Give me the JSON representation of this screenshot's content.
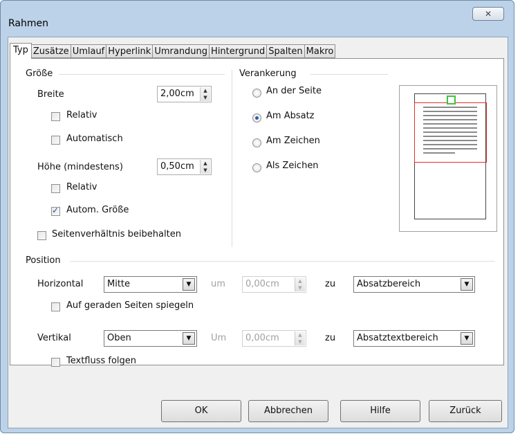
{
  "window": {
    "title": "Rahmen",
    "close_icon": "close-icon"
  },
  "tabs": [
    "Typ",
    "Zusätze",
    "Umlauf",
    "Hyperlink",
    "Umrandung",
    "Hintergrund",
    "Spalten",
    "Makro"
  ],
  "groesse": {
    "title": "Größe",
    "breite_label": "Breite",
    "breite_value": "2,00cm",
    "relativ1_label": "Relativ",
    "automatisch_label": "Automatisch",
    "hoehe_label": "Höhe (mindestens)",
    "hoehe_value": "0,50cm",
    "relativ2_label": "Relativ",
    "autom_groesse_label": "Autom. Größe",
    "seitenverhaeltnis_label": "Seitenverhältnis beibehalten"
  },
  "states": {
    "relativ1": false,
    "automatisch": false,
    "relativ2": false,
    "autom_groesse": true,
    "seitenverhaeltnis": false,
    "auf_geraden": false,
    "textfluss": false
  },
  "verankerung": {
    "title": "Verankerung",
    "options": [
      "An der Seite",
      "Am Absatz",
      "Am Zeichen",
      "Als Zeichen"
    ],
    "selected": 1
  },
  "position": {
    "title": "Position",
    "horizontal_label": "Horizontal",
    "horizontal_value": "Mitte",
    "um1_label": "um",
    "um1_value": "0,00cm",
    "zu1_label": "zu",
    "zu1_value": "Absatzbereich",
    "spiegeln_label": "Auf geraden Seiten spiegeln",
    "vertikal_label": "Vertikal",
    "vertikal_value": "Oben",
    "um2_label": "Um",
    "um2_value": "0,00cm",
    "zu2_label": "zu",
    "zu2_value": "Absatztextbereich",
    "textfluss_label": "Textfluss folgen"
  },
  "buttons": {
    "ok": "OK",
    "abbrechen": "Abbrechen",
    "hilfe": "Hilfe",
    "zurueck": "Zurück"
  },
  "colors": {
    "paragraph_border": "#e0302a",
    "frame_border": "#3ec33e"
  }
}
